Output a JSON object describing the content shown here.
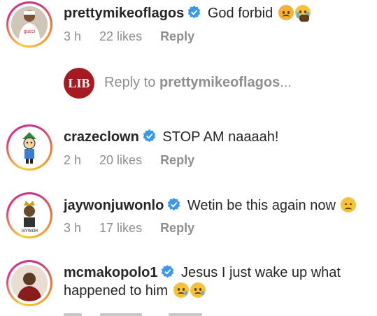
{
  "comments": [
    {
      "username": "prettymikeoflagos",
      "text": "God forbid",
      "time": "3 h",
      "likes": "22 likes",
      "reply_label": "Reply",
      "emojis": [
        "angry-face",
        "crying-face"
      ]
    },
    {
      "username": "crazeclown",
      "text": "STOP AM naaaah!",
      "time": "2 h",
      "likes": "20 likes",
      "reply_label": "Reply"
    },
    {
      "username": "jaywonjuwonlo",
      "text": "Wetin be this again now",
      "time": "3 h",
      "likes": "17 likes",
      "reply_label": "Reply",
      "emojis": [
        "disappointed-face"
      ]
    },
    {
      "username": "mcmakopolo1",
      "text": "Jesus I just wake up what",
      "text_line2": "happened to him",
      "emojis": [
        "sad-tear-face",
        "sad-tear-face"
      ]
    }
  ],
  "reply_input": {
    "avatar_text": "LIB",
    "prompt_prefix": "Reply to",
    "prompt_username": "prettymikeoflagos",
    "prompt_suffix": "..."
  },
  "colors": {
    "verified": "#3897f0",
    "meta": "#8e8e8e",
    "lib_brand": "#a61b22"
  }
}
